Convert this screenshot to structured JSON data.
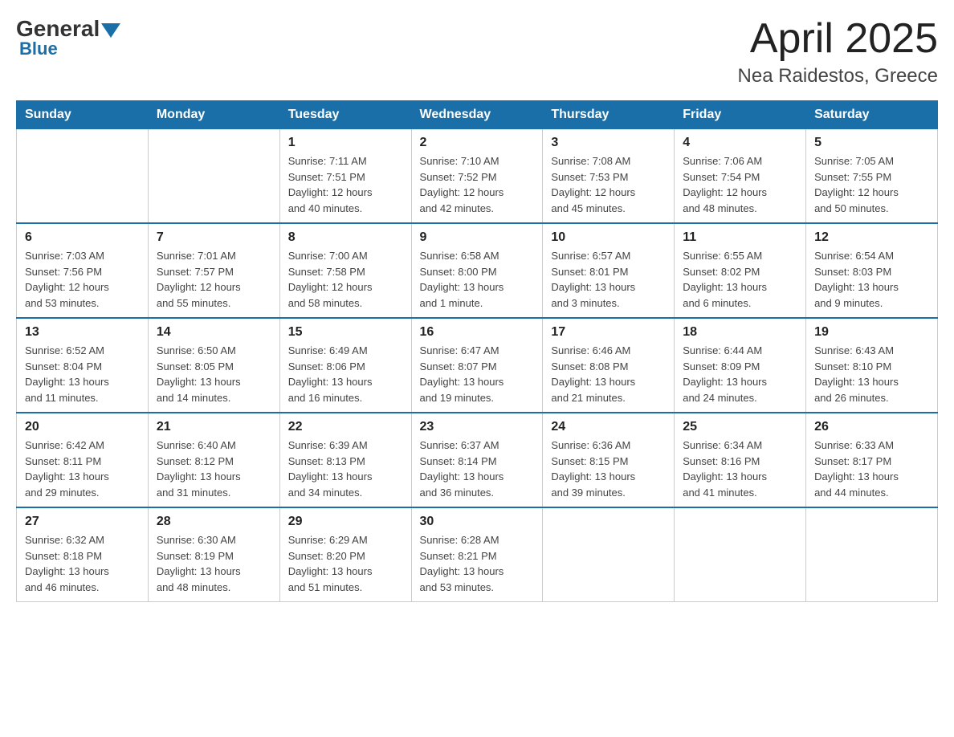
{
  "header": {
    "logo_general": "General",
    "logo_blue": "Blue",
    "main_title": "April 2025",
    "subtitle": "Nea Raidestos, Greece"
  },
  "days_of_week": [
    "Sunday",
    "Monday",
    "Tuesday",
    "Wednesday",
    "Thursday",
    "Friday",
    "Saturday"
  ],
  "weeks": [
    [
      {
        "day": "",
        "info": ""
      },
      {
        "day": "",
        "info": ""
      },
      {
        "day": "1",
        "info": "Sunrise: 7:11 AM\nSunset: 7:51 PM\nDaylight: 12 hours\nand 40 minutes."
      },
      {
        "day": "2",
        "info": "Sunrise: 7:10 AM\nSunset: 7:52 PM\nDaylight: 12 hours\nand 42 minutes."
      },
      {
        "day": "3",
        "info": "Sunrise: 7:08 AM\nSunset: 7:53 PM\nDaylight: 12 hours\nand 45 minutes."
      },
      {
        "day": "4",
        "info": "Sunrise: 7:06 AM\nSunset: 7:54 PM\nDaylight: 12 hours\nand 48 minutes."
      },
      {
        "day": "5",
        "info": "Sunrise: 7:05 AM\nSunset: 7:55 PM\nDaylight: 12 hours\nand 50 minutes."
      }
    ],
    [
      {
        "day": "6",
        "info": "Sunrise: 7:03 AM\nSunset: 7:56 PM\nDaylight: 12 hours\nand 53 minutes."
      },
      {
        "day": "7",
        "info": "Sunrise: 7:01 AM\nSunset: 7:57 PM\nDaylight: 12 hours\nand 55 minutes."
      },
      {
        "day": "8",
        "info": "Sunrise: 7:00 AM\nSunset: 7:58 PM\nDaylight: 12 hours\nand 58 minutes."
      },
      {
        "day": "9",
        "info": "Sunrise: 6:58 AM\nSunset: 8:00 PM\nDaylight: 13 hours\nand 1 minute."
      },
      {
        "day": "10",
        "info": "Sunrise: 6:57 AM\nSunset: 8:01 PM\nDaylight: 13 hours\nand 3 minutes."
      },
      {
        "day": "11",
        "info": "Sunrise: 6:55 AM\nSunset: 8:02 PM\nDaylight: 13 hours\nand 6 minutes."
      },
      {
        "day": "12",
        "info": "Sunrise: 6:54 AM\nSunset: 8:03 PM\nDaylight: 13 hours\nand 9 minutes."
      }
    ],
    [
      {
        "day": "13",
        "info": "Sunrise: 6:52 AM\nSunset: 8:04 PM\nDaylight: 13 hours\nand 11 minutes."
      },
      {
        "day": "14",
        "info": "Sunrise: 6:50 AM\nSunset: 8:05 PM\nDaylight: 13 hours\nand 14 minutes."
      },
      {
        "day": "15",
        "info": "Sunrise: 6:49 AM\nSunset: 8:06 PM\nDaylight: 13 hours\nand 16 minutes."
      },
      {
        "day": "16",
        "info": "Sunrise: 6:47 AM\nSunset: 8:07 PM\nDaylight: 13 hours\nand 19 minutes."
      },
      {
        "day": "17",
        "info": "Sunrise: 6:46 AM\nSunset: 8:08 PM\nDaylight: 13 hours\nand 21 minutes."
      },
      {
        "day": "18",
        "info": "Sunrise: 6:44 AM\nSunset: 8:09 PM\nDaylight: 13 hours\nand 24 minutes."
      },
      {
        "day": "19",
        "info": "Sunrise: 6:43 AM\nSunset: 8:10 PM\nDaylight: 13 hours\nand 26 minutes."
      }
    ],
    [
      {
        "day": "20",
        "info": "Sunrise: 6:42 AM\nSunset: 8:11 PM\nDaylight: 13 hours\nand 29 minutes."
      },
      {
        "day": "21",
        "info": "Sunrise: 6:40 AM\nSunset: 8:12 PM\nDaylight: 13 hours\nand 31 minutes."
      },
      {
        "day": "22",
        "info": "Sunrise: 6:39 AM\nSunset: 8:13 PM\nDaylight: 13 hours\nand 34 minutes."
      },
      {
        "day": "23",
        "info": "Sunrise: 6:37 AM\nSunset: 8:14 PM\nDaylight: 13 hours\nand 36 minutes."
      },
      {
        "day": "24",
        "info": "Sunrise: 6:36 AM\nSunset: 8:15 PM\nDaylight: 13 hours\nand 39 minutes."
      },
      {
        "day": "25",
        "info": "Sunrise: 6:34 AM\nSunset: 8:16 PM\nDaylight: 13 hours\nand 41 minutes."
      },
      {
        "day": "26",
        "info": "Sunrise: 6:33 AM\nSunset: 8:17 PM\nDaylight: 13 hours\nand 44 minutes."
      }
    ],
    [
      {
        "day": "27",
        "info": "Sunrise: 6:32 AM\nSunset: 8:18 PM\nDaylight: 13 hours\nand 46 minutes."
      },
      {
        "day": "28",
        "info": "Sunrise: 6:30 AM\nSunset: 8:19 PM\nDaylight: 13 hours\nand 48 minutes."
      },
      {
        "day": "29",
        "info": "Sunrise: 6:29 AM\nSunset: 8:20 PM\nDaylight: 13 hours\nand 51 minutes."
      },
      {
        "day": "30",
        "info": "Sunrise: 6:28 AM\nSunset: 8:21 PM\nDaylight: 13 hours\nand 53 minutes."
      },
      {
        "day": "",
        "info": ""
      },
      {
        "day": "",
        "info": ""
      },
      {
        "day": "",
        "info": ""
      }
    ]
  ]
}
